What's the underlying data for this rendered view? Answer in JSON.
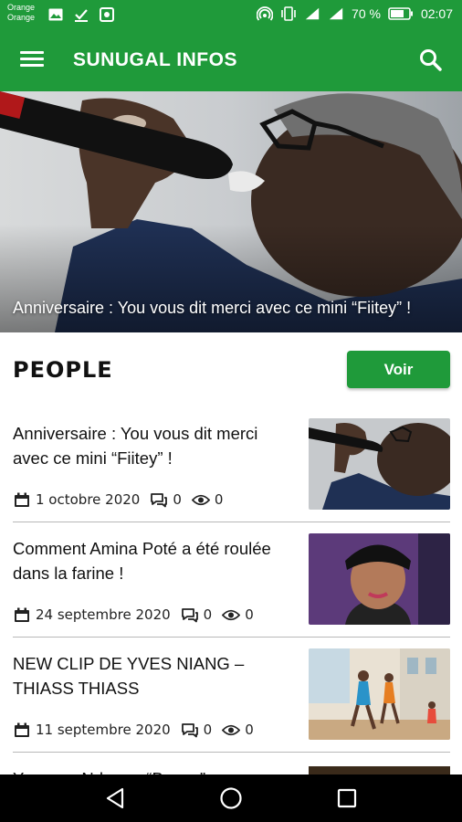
{
  "status_bar": {
    "carrier_line1": "Orange",
    "carrier_line2": "Orange",
    "battery": "70 %",
    "time": "02:07"
  },
  "app_bar": {
    "title": "SUNUGAL INFOS"
  },
  "hero": {
    "caption": "Anniversaire : You vous dit merci avec ce mini “Fiitey” !"
  },
  "section": {
    "title": "PEOPLE",
    "voir_label": "Voir"
  },
  "articles": [
    {
      "title": "Anniversaire : You vous dit merci avec ce mini “Fiitey” !",
      "date": "1 octobre 2020",
      "comments": "0",
      "views": "0"
    },
    {
      "title": "Comment Amina Poté a été roulée dans la farine !",
      "date": "24 septembre 2020",
      "comments": "0",
      "views": "0"
    },
    {
      "title": "NEW CLIP DE YVES NIANG – THIASS THIASS",
      "date": "11 septembre 2020",
      "comments": "0",
      "views": "0"
    },
    {
      "title": "Youssou Ndour – “Baayo” ...",
      "date": "",
      "comments": "",
      "views": ""
    }
  ],
  "colors": {
    "brand_green": "#1f9a3a",
    "nav_black": "#000000"
  },
  "icons": [
    "menu-icon",
    "search-icon",
    "calendar-icon",
    "comment-icon",
    "eye-icon",
    "back-icon",
    "home-icon",
    "recents-icon"
  ]
}
